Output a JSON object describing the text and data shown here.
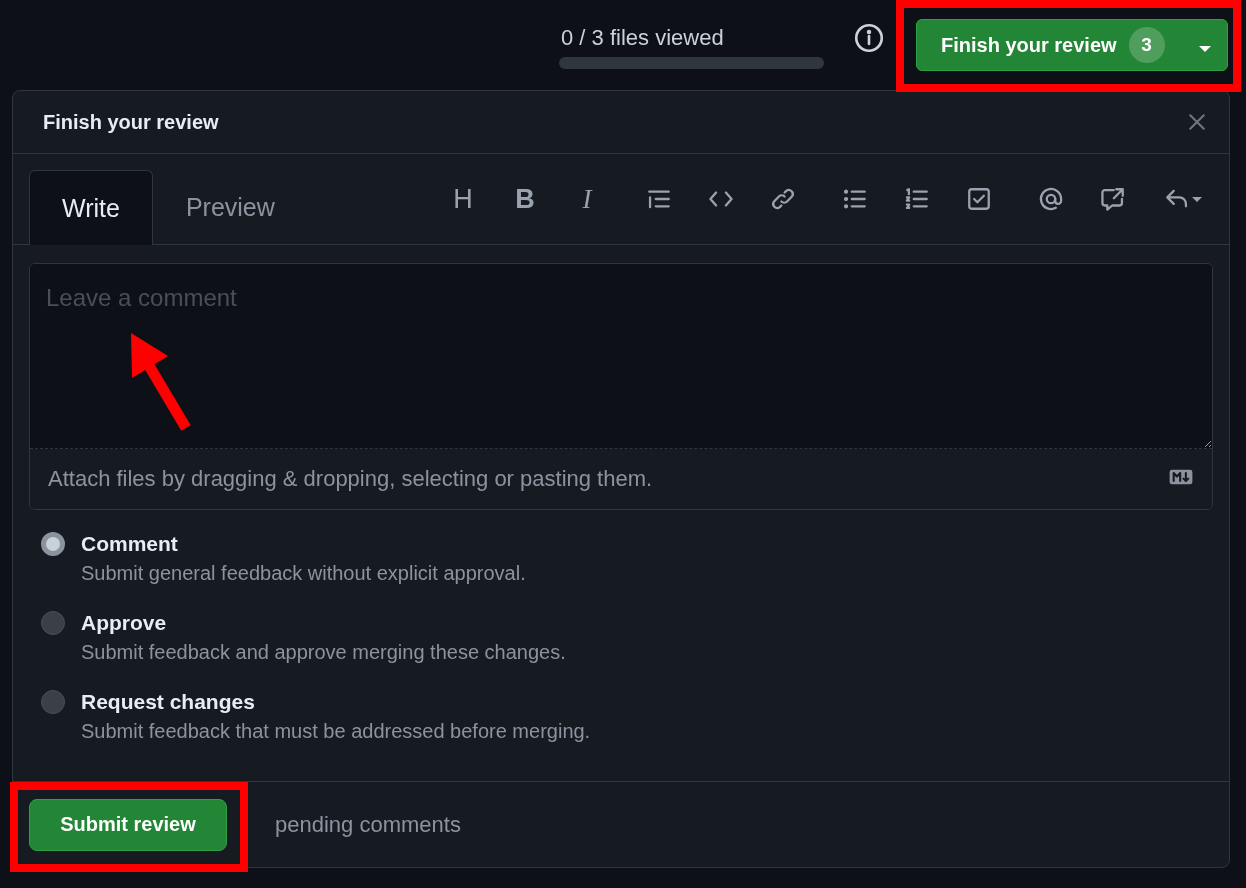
{
  "top_bar": {
    "files_viewed": "0 / 3 files viewed",
    "progress": {
      "level": 0
    },
    "finish_button": {
      "label": "Finish your review",
      "count": "3"
    }
  },
  "dialog": {
    "title": "Finish your review",
    "tabs": [
      {
        "label": "Write",
        "selected": true
      },
      {
        "label": "Preview",
        "selected": false
      }
    ],
    "toolbar_groups": [
      [
        {
          "kind": "heading",
          "label": "H"
        },
        {
          "kind": "bold",
          "label": "B"
        },
        {
          "kind": "italic",
          "label": "I"
        }
      ],
      [
        {
          "kind": "quote"
        },
        {
          "kind": "code"
        },
        {
          "kind": "link"
        }
      ],
      [
        {
          "kind": "bullet-list"
        },
        {
          "kind": "numbered-list"
        },
        {
          "kind": "task-list"
        }
      ],
      [
        {
          "kind": "mention"
        },
        {
          "kind": "reference"
        },
        {
          "kind": "reply"
        }
      ]
    ],
    "comment": {
      "placeholder": "Leave a comment",
      "attach_hint": "Attach files by dragging & dropping, selecting or pasting them."
    },
    "options": [
      {
        "label": "Comment",
        "description": "Submit general feedback without explicit approval.",
        "selected": true
      },
      {
        "label": "Approve",
        "description": "Submit feedback and approve merging these changes.",
        "selected": false
      },
      {
        "label": "Request changes",
        "description": "Submit feedback that must be addressed before merging.",
        "selected": false
      }
    ],
    "footer": {
      "submit_label": "Submit review",
      "pending": "pending comments"
    }
  }
}
